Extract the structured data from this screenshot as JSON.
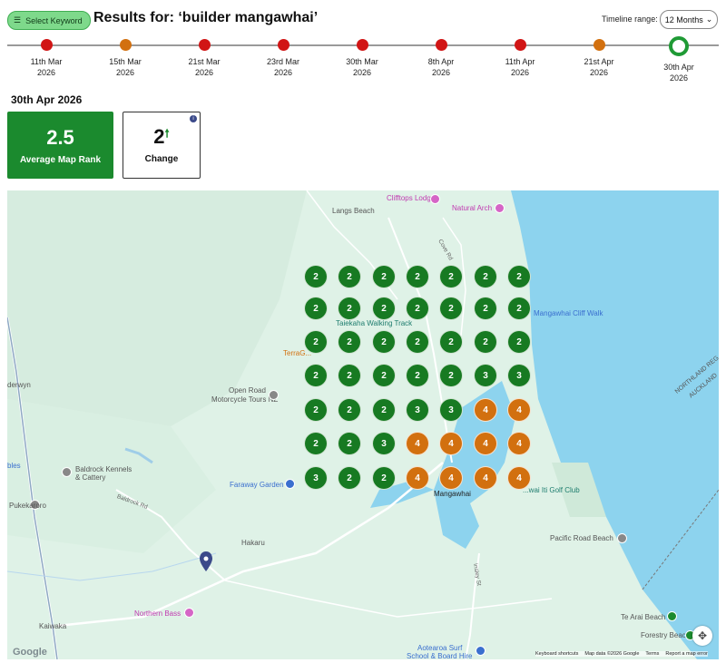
{
  "header": {
    "keyword_button": "Select Keyword",
    "title": "Results for: ‘builder mangawhai’",
    "timeline_label": "Timeline range:",
    "timeline_value": "12 Months"
  },
  "timeline": [
    {
      "date": "11th Mar",
      "year": "2026",
      "status": "red"
    },
    {
      "date": "15th Mar",
      "year": "2026",
      "status": "orange"
    },
    {
      "date": "21st Mar",
      "year": "2026",
      "status": "red"
    },
    {
      "date": "23rd Mar",
      "year": "2026",
      "status": "red"
    },
    {
      "date": "30th Mar",
      "year": "2026",
      "status": "red"
    },
    {
      "date": "8th Apr",
      "year": "2026",
      "status": "red"
    },
    {
      "date": "11th Apr",
      "year": "2026",
      "status": "red"
    },
    {
      "date": "21st Apr",
      "year": "2026",
      "status": "orange"
    },
    {
      "date": "30th Apr",
      "year": "2026",
      "status": "selected"
    }
  ],
  "summary": {
    "date": "30th Apr 2026",
    "average_rank": "2.5",
    "average_label": "Average Map Rank",
    "change_value": "2",
    "change_label": "Change",
    "change_direction": "up"
  },
  "colors": {
    "green": "#177a22",
    "orange": "#d2700f",
    "red": "#d11515",
    "water": "#8dd3ee"
  },
  "grid": [
    [
      2,
      2,
      2,
      2,
      2,
      2,
      2
    ],
    [
      2,
      2,
      2,
      2,
      2,
      2,
      2
    ],
    [
      2,
      2,
      2,
      2,
      2,
      2,
      2
    ],
    [
      2,
      2,
      2,
      2,
      2,
      3,
      3
    ],
    [
      2,
      2,
      2,
      3,
      3,
      4,
      4
    ],
    [
      2,
      2,
      3,
      4,
      4,
      4,
      4
    ],
    [
      3,
      2,
      2,
      4,
      4,
      4,
      4
    ]
  ],
  "map": {
    "places": {
      "cliffttops": "Clifftops Lodge",
      "langs": "Langs Beach",
      "natural_arch": "Natural Arch",
      "cove_rd": "Cove Rd",
      "taiekaha": "Taiekaha Walking Track",
      "mangawhai_cliff": "Mangawhai Cliff Walk",
      "terrag": "TerraG...",
      "derwyn": "derwyn",
      "open_road_1": "Open Road",
      "open_road_2": "Motorcycle Tours NZ",
      "northland": "NORTHLAND REG",
      "auckland": "AUCKLAND",
      "baldrock_1": "Baldrock Kennels",
      "baldrock_2": "& Cattery",
      "bles": "bles",
      "faraway": "Faraway Garden",
      "puke": "Pukekaroro",
      "baldrock_rd": "Baldrock Rd",
      "mangawhai": "Mangawhai",
      "mangawhai_golf": "...wai Iti Golf Club",
      "hakaru": "Hakaru",
      "pacific_road": "Pacific Road Beach",
      "northern_bass": "Northern Bass",
      "kaiwaka": "Kaiwaka",
      "te_arai": "Te Arai Beach",
      "forestry": "Forestry Beach",
      "aotearoa_1": "Aotearoa Surf",
      "aotearoa_2": "School & Board Hire",
      "insley": "Insley St"
    },
    "google": "Google",
    "attribution": [
      "Keyboard shortcuts",
      "Map data ©2026 Google",
      "Terms",
      "Report a map error"
    ]
  }
}
